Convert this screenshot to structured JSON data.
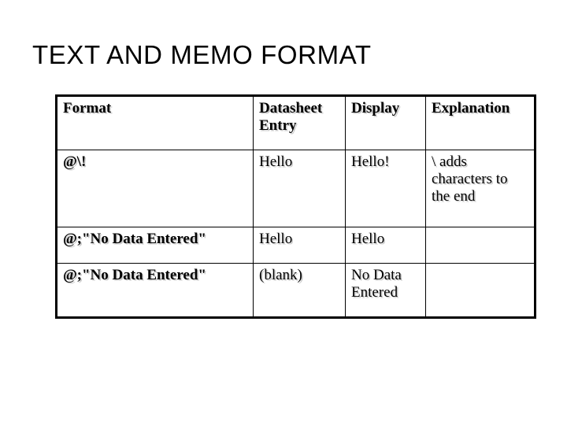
{
  "slide": {
    "title": "TEXT AND MEMO FORMAT",
    "background_color": "#ffffff",
    "text_color": "#000000",
    "shadow_color": "#c9c9c9"
  },
  "table": {
    "headers": [
      "Format",
      "Datasheet Entry",
      "Display",
      "Explanation"
    ],
    "rows": [
      {
        "format": "@\\!",
        "datasheet_entry": "Hello",
        "display": "Hello!",
        "explanation": "\\ adds characters to the end"
      },
      {
        "format": "@;\"No Data Entered\"",
        "datasheet_entry": "Hello",
        "display": "Hello",
        "explanation": ""
      },
      {
        "format": "@;\"No Data Entered\"",
        "datasheet_entry": "(blank)",
        "display": "No Data Entered",
        "explanation": ""
      }
    ]
  }
}
